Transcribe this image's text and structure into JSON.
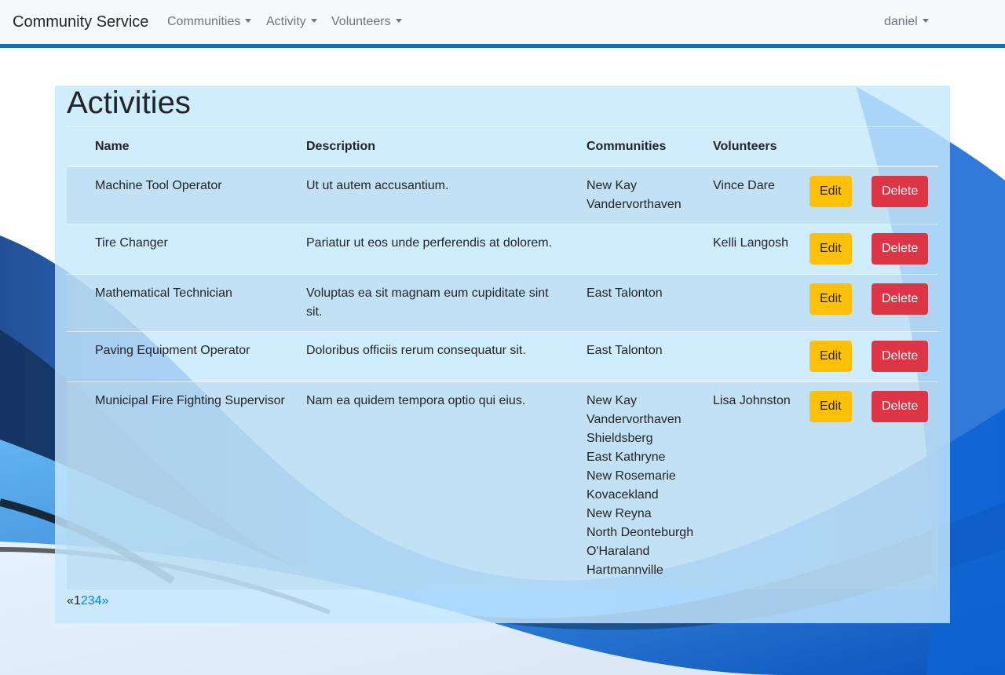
{
  "navbar": {
    "brand": "Community Service",
    "menus": [
      "Communities",
      "Activity",
      "Volunteers"
    ],
    "user": "daniel"
  },
  "page": {
    "title": "Activities"
  },
  "table": {
    "headers": [
      "Name",
      "Description",
      "Communities",
      "Volunteers"
    ],
    "edit_label": "Edit",
    "delete_label": "Delete",
    "rows": [
      {
        "name": "Machine Tool Operator",
        "description": "Ut ut autem accusantium.",
        "communities": [
          "New Kay",
          "Vandervorthaven"
        ],
        "volunteers": "Vince Dare"
      },
      {
        "name": "Tire Changer",
        "description": "Pariatur ut eos unde perferendis at dolorem.",
        "communities": [],
        "volunteers": "Kelli Langosh"
      },
      {
        "name": "Mathematical Technician",
        "description": "Voluptas ea sit magnam eum cupiditate sint sit.",
        "communities": [
          "East Talonton"
        ],
        "volunteers": ""
      },
      {
        "name": "Paving Equipment Operator",
        "description": "Doloribus officiis rerum consequatur sit.",
        "communities": [
          "East Talonton"
        ],
        "volunteers": ""
      },
      {
        "name": "Municipal Fire Fighting Supervisor",
        "description": "Nam ea quidem tempora optio qui eius.",
        "communities": [
          "New Kay",
          "Vandervorthaven",
          "Shieldsberg",
          "East Kathryne",
          "New Rosemarie",
          "Kovacekland",
          "New Reyna",
          "North Deonteburgh",
          "O'Haraland",
          "Hartmannville"
        ],
        "volunteers": "Lisa Johnston"
      }
    ]
  },
  "pagination": {
    "prev": "«",
    "pages": [
      "1",
      "2",
      "3",
      "4"
    ],
    "current": "1",
    "next": "»"
  },
  "colors": {
    "accent_bar": "#1170b4",
    "edit_button": "#ffc107",
    "delete_button": "#dc3545",
    "link": "#007bff"
  }
}
